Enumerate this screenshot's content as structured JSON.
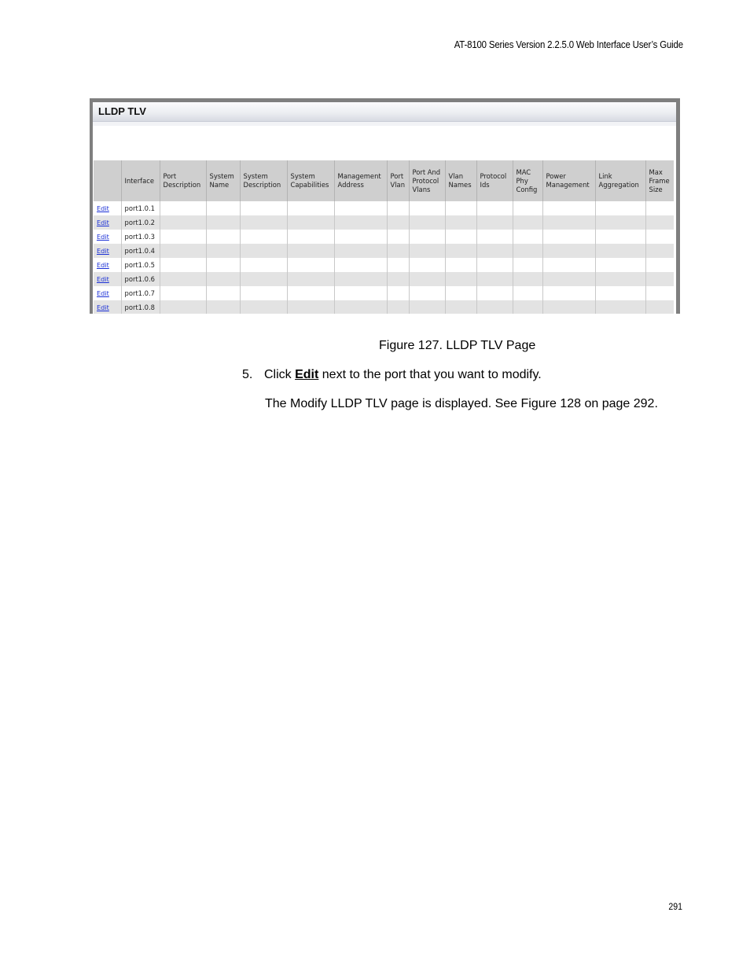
{
  "document": {
    "running_header": "AT-8100 Series Version 2.2.5.0 Web Interface User’s Guide",
    "page_number": "291"
  },
  "figure": {
    "panel_title": "LLDP TLV",
    "columns": [
      "",
      "Interface",
      "Port Description",
      "System Name",
      "System Description",
      "System Capabilities",
      "Management Address",
      "Port Vlan",
      "Port And Protocol Vlans",
      "Vlan Names",
      "Protocol Ids",
      "MAC Phy Config",
      "Power Management",
      "Link Aggregation",
      "Max Frame Size"
    ],
    "edit_label": "Edit",
    "rows": [
      {
        "edit": "Edit",
        "interface": "port1.0.1",
        "cells": [
          "",
          "",
          "",
          "",
          "",
          "",
          "",
          "",
          "",
          "",
          "",
          "",
          ""
        ]
      },
      {
        "edit": "Edit",
        "interface": "port1.0.2",
        "cells": [
          "",
          "",
          "",
          "",
          "",
          "",
          "",
          "",
          "",
          "",
          "",
          "",
          ""
        ]
      },
      {
        "edit": "Edit",
        "interface": "port1.0.3",
        "cells": [
          "",
          "",
          "",
          "",
          "",
          "",
          "",
          "",
          "",
          "",
          "",
          "",
          ""
        ]
      },
      {
        "edit": "Edit",
        "interface": "port1.0.4",
        "cells": [
          "",
          "",
          "",
          "",
          "",
          "",
          "",
          "",
          "",
          "",
          "",
          "",
          ""
        ]
      },
      {
        "edit": "Edit",
        "interface": "port1.0.5",
        "cells": [
          "",
          "",
          "",
          "",
          "",
          "",
          "",
          "",
          "",
          "",
          "",
          "",
          ""
        ]
      },
      {
        "edit": "Edit",
        "interface": "port1.0.6",
        "cells": [
          "",
          "",
          "",
          "",
          "",
          "",
          "",
          "",
          "",
          "",
          "",
          "",
          ""
        ]
      },
      {
        "edit": "Edit",
        "interface": "port1.0.7",
        "cells": [
          "",
          "",
          "",
          "",
          "",
          "",
          "",
          "",
          "",
          "",
          "",
          "",
          ""
        ]
      },
      {
        "edit": "Edit",
        "interface": "port1.0.8",
        "cells": [
          "",
          "",
          "",
          "",
          "",
          "",
          "",
          "",
          "",
          "",
          "",
          "",
          ""
        ]
      }
    ],
    "caption": "Figure 127. LLDP TLV Page"
  },
  "body": {
    "step_number": "5.",
    "step_prefix": "Click ",
    "step_bold": "Edit",
    "step_suffix": " next to the port that you want to modify.",
    "paragraph": "The Modify LLDP TLV page is displayed. See Figure 128 on page 292."
  },
  "colors": {
    "link": "#1a2fd6",
    "header_bg": "#cfcfcf",
    "row_alt_bg": "#e3e3e3",
    "frame": "#7f7f7f"
  }
}
